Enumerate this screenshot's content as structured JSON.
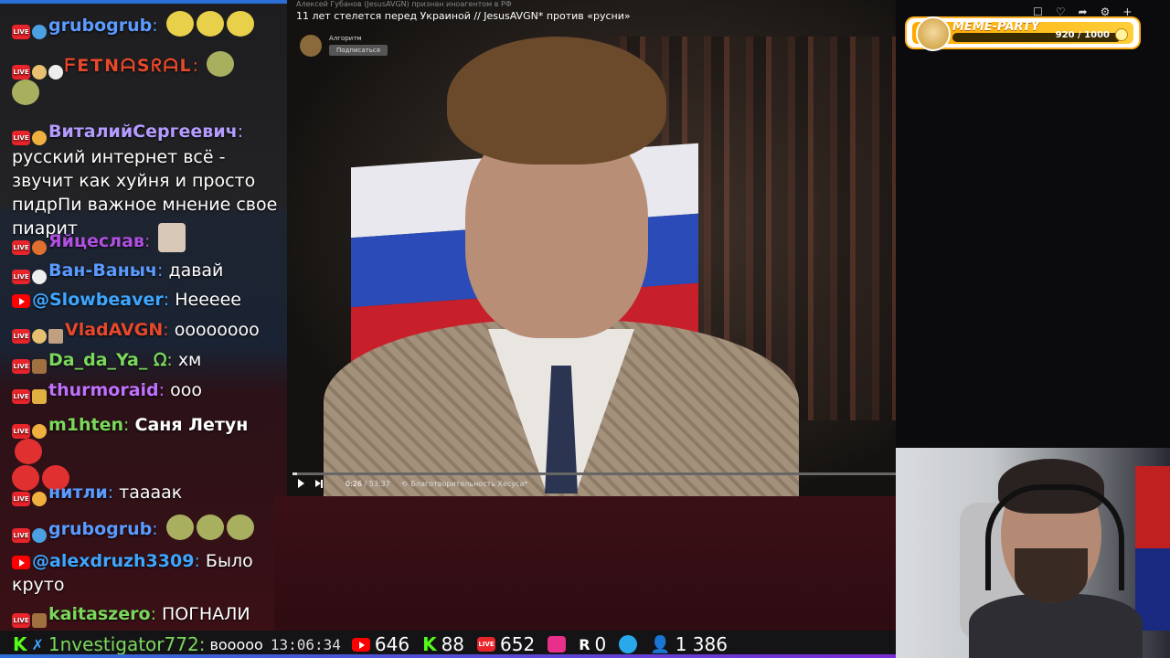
{
  "video": {
    "title_faint": "Алексей Губанов (JesusAVGN) признан иноагентом в РФ",
    "title": "11 лет стелется перед Украиной // JesusAVGN* против «русни»",
    "channel": "Алгоритм",
    "subscribe_label": "Подписаться",
    "time_current": "0:26",
    "time_separator": " / ",
    "time_total": "53:37",
    "chapter": "Благотворительность Хесуса*",
    "progress": 0.008
  },
  "meme_party": {
    "title": "MEME-PARTY",
    "count": "920 / 1000",
    "progress": 0.92
  },
  "chat": [
    {
      "platform": "vk",
      "nick": "grubogrub",
      "nick_color": "#5b9bff",
      "text": "",
      "emotes": 3,
      "emote_color": "#e8d04a"
    },
    {
      "platform": "vk",
      "nick": "ᖴETNᗩSᖇᗩL",
      "nick_color": "#e8482b",
      "text": "",
      "emotes": 2,
      "emote_color": "#a8b060"
    },
    {
      "platform": "vk",
      "nick": "ВиталийСергеевич",
      "nick_color": "#b49cff",
      "text": "русский интернет всё - звучит как хуйня и просто пидрПи важное мнение свое пиарит",
      "emotes": 0,
      "emote_color": ""
    },
    {
      "platform": "vk",
      "nick": "Яйцеслав",
      "nick_color": "#b050e0",
      "text": "",
      "emotes": 1,
      "emote_color": "#d8c8b8"
    },
    {
      "platform": "vk",
      "nick": "Ван-Ваныч",
      "nick_color": "#5b9bff",
      "text": "давай",
      "emotes": 0,
      "emote_color": ""
    },
    {
      "platform": "yt",
      "nick": "@Slowbeaver",
      "nick_color": "#3ea6ff",
      "text": "Нееeee",
      "emotes": 0,
      "emote_color": ""
    },
    {
      "platform": "vk",
      "nick": "VladAVGN",
      "nick_color": "#e8482b",
      "text": "оооооооо",
      "emotes": 0,
      "emote_color": ""
    },
    {
      "platform": "vk",
      "nick": "Da_da_Ya_ ᘯ",
      "nick_color": "#7ad85b",
      "text": "хм",
      "emotes": 0,
      "emote_color": ""
    },
    {
      "platform": "vk",
      "nick": "thurmoraid",
      "nick_color": "#c070ff",
      "text": "ооо",
      "emotes": 0,
      "emote_color": ""
    },
    {
      "platform": "vk",
      "nick": "m1hten",
      "nick_color": "#7ad85b",
      "text": "Саня Летун",
      "emotes": 3,
      "emote_color": "#e03030"
    },
    {
      "platform": "vk",
      "nick": "нитли",
      "nick_color": "#5b9bff",
      "text": "тааaак",
      "emotes": 0,
      "emote_color": ""
    },
    {
      "platform": "vk",
      "nick": "grubogrub",
      "nick_color": "#5b9bff",
      "text": "",
      "emotes": 3,
      "emote_color": "#a8b060"
    },
    {
      "platform": "yt",
      "nick": "@alexdruzh3309",
      "nick_color": "#3ea6ff",
      "text": "Было круто",
      "emotes": 0,
      "emote_color": ""
    },
    {
      "platform": "vk",
      "nick": "kaitaszero",
      "nick_color": "#7ad85b",
      "text": "ПОГНАЛИ",
      "emotes": 0,
      "emote_color": ""
    }
  ],
  "bottom": {
    "last_nick": "1nvestigator772",
    "last_text": "воoooo",
    "time": "13:06:34",
    "youtube_viewers": "646",
    "kick_viewers": "88",
    "vklive_viewers": "652",
    "rutube_viewers": "0",
    "total_viewers": "1 386",
    "colors": {
      "youtube": "#ff0000",
      "kick": "#53fc18",
      "vklive": "#e8252b",
      "rutube": "#ffffff",
      "telegram": "#29a9eb",
      "total": "#3ea6ff"
    }
  }
}
